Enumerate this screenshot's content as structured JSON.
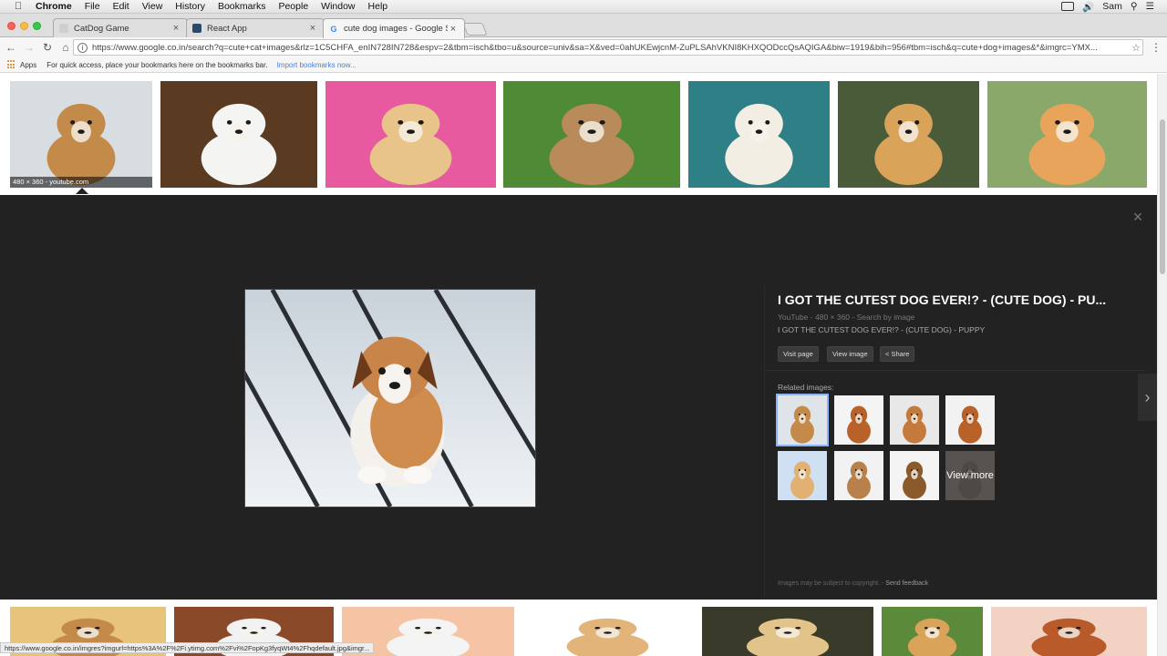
{
  "menubar": {
    "app": "Chrome",
    "items": [
      "File",
      "Edit",
      "View",
      "History",
      "Bookmarks",
      "People",
      "Window",
      "Help"
    ],
    "user": "Sam"
  },
  "tabs": [
    {
      "title": "CatDog Game",
      "favicon_color": "#cfcfcf"
    },
    {
      "title": "React App",
      "favicon_color": "#2b4a6b"
    },
    {
      "title": "cute dog images - Google Sea",
      "favicon_color": "#4285f4",
      "active": true
    }
  ],
  "toolbar": {
    "url": "https://www.google.co.in/search?q=cute+cat+images&rlz=1C5CHFA_enIN728IN728&espv=2&tbm=isch&tbo=u&source=univ&sa=X&ved=0ahUKEwjcnM-ZuPLSAhVKNI8KHXQODccQsAQIGA&biw=1919&bih=956#tbm=isch&q=cute+dog+images&*&imgrc=YMX..."
  },
  "bookmarks": {
    "apps_label": "Apps",
    "hint": "For quick access, place your bookmarks here on the bookmarks bar.",
    "import_link": "Import bookmarks now..."
  },
  "results_row1": [
    {
      "bg": "#d8dde2",
      "fg": "#c48a4a",
      "label": "480 × 360 - youtube.com"
    },
    {
      "bg": "#5a3a20",
      "fg": "#f4f4f2"
    },
    {
      "bg": "#e85aa0",
      "fg": "#e8c48a"
    },
    {
      "bg": "#4f8a35",
      "fg": "#b98a5a"
    },
    {
      "bg": "#2f7f86",
      "fg": "#f2eee4"
    },
    {
      "bg": "#4a5b3a",
      "fg": "#d9a45a"
    },
    {
      "bg": "#8aa86a",
      "fg": "#e8a45a"
    }
  ],
  "results_row2": [
    {
      "bg": "#e7c47a",
      "fg": "#c48a4a"
    },
    {
      "bg": "#8a4a2a",
      "fg": "#f2f2f2"
    },
    {
      "bg": "#f4c4a4",
      "fg": "#f4f4f4"
    },
    {
      "bg": "#ffffff",
      "fg": "#e2b47a"
    },
    {
      "bg": "#3a3a2a",
      "fg": "#e2c48a"
    },
    {
      "bg": "#5a8a3a",
      "fg": "#d9a45a"
    },
    {
      "bg": "#f2d2c2",
      "fg": "#b85a2a"
    }
  ],
  "preview": {
    "title": "I GOT THE CUTEST DOG EVER!? - (CUTE DOG) - PU...",
    "source": "YouTube",
    "dimensions": "480 × 360",
    "search_by_image": "Search by image",
    "description": "I GOT THE CUTEST DOG EVER!? - (CUTE DOG) - PUPPY",
    "visit_page": "Visit page",
    "view_image": "View image",
    "share": "Share",
    "related_label": "Related images:",
    "view_more": "View more",
    "copyright": "Images may be subject to copyright.",
    "send_feedback": "Send feedback"
  },
  "related": [
    {
      "bg": "#dfe4e8",
      "fg": "#c48a4a"
    },
    {
      "bg": "#f4f4f4",
      "fg": "#b8622a"
    },
    {
      "bg": "#e8e8e8",
      "fg": "#c47a3a"
    },
    {
      "bg": "#f2f2f2",
      "fg": "#b8622a"
    },
    {
      "bg": "#cfe0f2",
      "fg": "#e2b070"
    },
    {
      "bg": "#f2f2f2",
      "fg": "#b8804a"
    },
    {
      "bg": "#f4f4f4",
      "fg": "#8a5a2a"
    },
    {
      "bg": "#9a8a7a",
      "fg": "#7a6a5a"
    }
  ],
  "status_url": "https://www.google.co.in/imgres?imgurl=https%3A%2F%2Fi.ytimg.com%2Fvi%2FopKg3fyqWt4%2Fhqdefault.jpg&imgr..."
}
